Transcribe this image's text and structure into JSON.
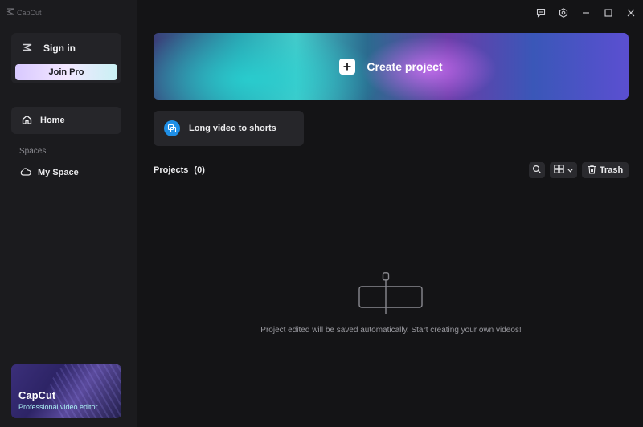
{
  "app": {
    "name": "CapCut"
  },
  "sidebar": {
    "sign_in_label": "Sign in",
    "join_pro_label": "Join Pro",
    "home_label": "Home",
    "spaces_label": "Spaces",
    "my_space_label": "My Space",
    "promo": {
      "title": "CapCut",
      "subtitle": "Professional video editor"
    }
  },
  "main": {
    "create_project_label": "Create project",
    "long_video_label": "Long video to shorts",
    "projects_label": "Projects",
    "projects_count": "(0)",
    "trash_label": "Trash",
    "empty_message": "Project edited will be saved automatically. Start creating your own videos!"
  },
  "icons": {
    "logo": "capcut-logo-icon",
    "feedback": "feedback-icon",
    "settings": "gear-icon",
    "minimize": "minimize-icon",
    "maximize": "maximize-icon",
    "close": "close-icon",
    "home": "home-icon",
    "cloud": "cloud-icon",
    "plus": "plus-icon",
    "shorts": "shorts-icon",
    "search": "search-icon",
    "grid": "grid-view-icon",
    "chevron": "chevron-down-icon",
    "trash": "trash-icon"
  },
  "colors": {
    "background": "#141416",
    "sidebar": "#1b1b1e",
    "card": "#26262a",
    "accent_blue": "#1f8fe6"
  }
}
